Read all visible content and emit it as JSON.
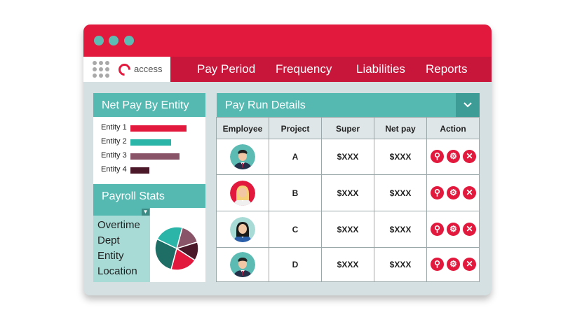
{
  "logo": {
    "text": "access"
  },
  "nav": {
    "items": [
      "Pay Period",
      "Frequency",
      "Liabilities",
      "Reports"
    ]
  },
  "net_pay_panel": {
    "title": "Net Pay By Entity",
    "entities": [
      {
        "label": "Entity 1",
        "value": 1.0,
        "color": "#e3183d"
      },
      {
        "label": "Entity 2",
        "value": 0.72,
        "color": "#2bb5a8"
      },
      {
        "label": "Entity 3",
        "value": 0.88,
        "color": "#8a5468"
      },
      {
        "label": "Entity 4",
        "value": 0.34,
        "color": "#4a1828"
      }
    ]
  },
  "payroll_stats": {
    "title": "Payroll Stats",
    "items": [
      "Overtime",
      "Dept",
      "Entity",
      "Location"
    ],
    "pie": [
      {
        "value": 0.16,
        "color": "#8a5468"
      },
      {
        "value": 0.14,
        "color": "#4a1828"
      },
      {
        "value": 0.2,
        "color": "#e3183d"
      },
      {
        "value": 0.28,
        "color": "#1e6e66"
      },
      {
        "value": 0.22,
        "color": "#2bb5a8"
      }
    ]
  },
  "pay_run": {
    "title": "Pay Run Details",
    "columns": [
      "Employee",
      "Project",
      "Super",
      "Net pay",
      "Action"
    ],
    "rows": [
      {
        "avatar": "male-employee-avatar",
        "project": "A",
        "super": "$XXX",
        "net_pay": "$XXX"
      },
      {
        "avatar": "female-blonde-employee-avatar",
        "project": "B",
        "super": "$XXX",
        "net_pay": "$XXX"
      },
      {
        "avatar": "female-employee-avatar",
        "project": "C",
        "super": "$XXX",
        "net_pay": "$XXX"
      },
      {
        "avatar": "male-employee-avatar",
        "project": "D",
        "super": "$XXX",
        "net_pay": "$XXX"
      }
    ],
    "actions": [
      "search-icon",
      "gear-icon",
      "close-icon"
    ]
  },
  "colors": {
    "brand_red": "#e3183d",
    "teal": "#55b9b2",
    "window_bg": "#d4e0e2"
  }
}
